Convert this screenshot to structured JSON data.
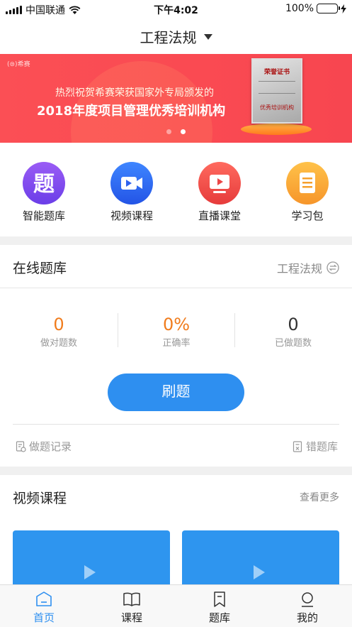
{
  "status": {
    "carrier": "中国联通",
    "time": "下午4:02",
    "battery": "100%",
    "battery_color": "#3ac43f"
  },
  "header": {
    "title": "工程法规",
    "dropdown_icon": "caret-down-icon"
  },
  "banner": {
    "brand": "希赛",
    "line1": "热烈祝贺希赛荣获国家外专局颁发的",
    "line2": "2018年度项目管理优秀培训机构",
    "cert_title": "荣誉证书",
    "cert_footer": "优秀培训机构",
    "active_slide": 2,
    "slide_count": 2
  },
  "quick_nav": [
    {
      "label": "智能题库",
      "icon": "question-bank-icon",
      "color": "#7a4ff0"
    },
    {
      "label": "视频课程",
      "icon": "video-camera-icon",
      "color": "#2f6cf4"
    },
    {
      "label": "直播课堂",
      "icon": "live-tv-icon",
      "color": "#f04b4b"
    },
    {
      "label": "学习包",
      "icon": "document-icon",
      "color": "#f8a52a"
    }
  ],
  "online_bank": {
    "title": "在线题库",
    "subject": "工程法规",
    "switch_icon": "switch-icon",
    "stats": [
      {
        "value": "0",
        "label": "做对题数",
        "color": "#f07c1d"
      },
      {
        "value": "0%",
        "label": "正确率",
        "color": "#f07c1d"
      },
      {
        "value": "0",
        "label": "已做题数",
        "color": "#333333"
      }
    ],
    "practice_button": "刷题",
    "records_link": "做题记录",
    "wrong_link": "错题库"
  },
  "video_section": {
    "title": "视频课程",
    "more": "查看更多"
  },
  "tabs": [
    {
      "label": "首页",
      "icon": "home-icon",
      "active": true
    },
    {
      "label": "课程",
      "icon": "book-icon",
      "active": false
    },
    {
      "label": "题库",
      "icon": "bookmark-icon",
      "active": false
    },
    {
      "label": "我的",
      "icon": "user-icon",
      "active": false
    }
  ],
  "accent_color": "#2e8ff0"
}
